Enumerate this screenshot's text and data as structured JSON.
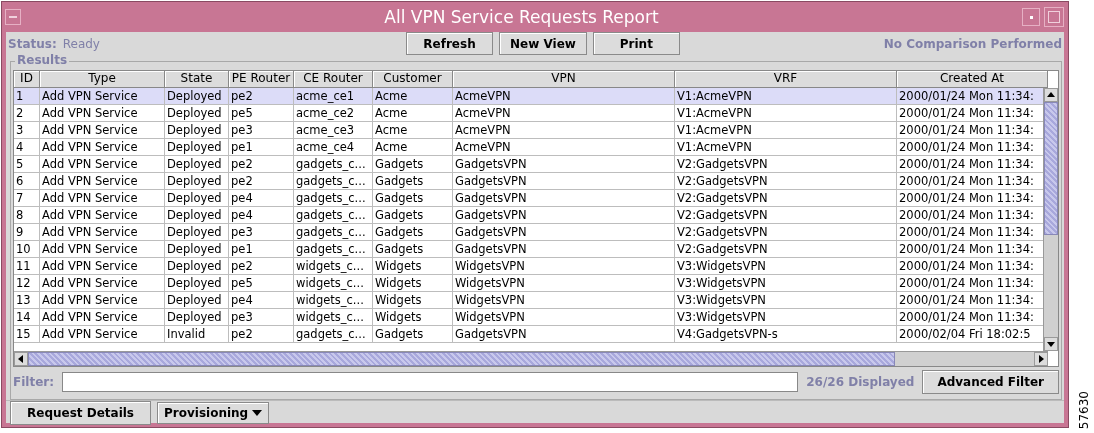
{
  "window": {
    "title": "All VPN Service Requests Report"
  },
  "toolbar": {
    "status_label": "Status:",
    "status_value": "Ready",
    "buttons": [
      "Refresh",
      "New View",
      "Print"
    ],
    "comparison": "No Comparison Performed"
  },
  "results": {
    "title": "Results",
    "columns": [
      "ID",
      "Type",
      "State",
      "PE Router",
      "CE Router",
      "Customer",
      "VPN",
      "VRF",
      "Created At"
    ],
    "rows": [
      {
        "selected": true,
        "cells": [
          "1",
          "Add VPN Service",
          "Deployed",
          "pe2",
          "acme_ce1",
          "Acme",
          "AcmeVPN",
          "V1:AcmeVPN",
          "2000/01/24 Mon 11:34:"
        ]
      },
      {
        "selected": false,
        "cells": [
          "2",
          "Add VPN Service",
          "Deployed",
          "pe5",
          "acme_ce2",
          "Acme",
          "AcmeVPN",
          "V1:AcmeVPN",
          "2000/01/24 Mon 11:34:"
        ]
      },
      {
        "selected": false,
        "cells": [
          "3",
          "Add VPN Service",
          "Deployed",
          "pe3",
          "acme_ce3",
          "Acme",
          "AcmeVPN",
          "V1:AcmeVPN",
          "2000/01/24 Mon 11:34:"
        ]
      },
      {
        "selected": false,
        "cells": [
          "4",
          "Add VPN Service",
          "Deployed",
          "pe1",
          "acme_ce4",
          "Acme",
          "AcmeVPN",
          "V1:AcmeVPN",
          "2000/01/24 Mon 11:34:"
        ]
      },
      {
        "selected": false,
        "cells": [
          "5",
          "Add VPN Service",
          "Deployed",
          "pe2",
          "gadgets_c...",
          "Gadgets",
          "GadgetsVPN",
          "V2:GadgetsVPN",
          "2000/01/24 Mon 11:34:"
        ]
      },
      {
        "selected": false,
        "cells": [
          "6",
          "Add VPN Service",
          "Deployed",
          "pe2",
          "gadgets_c...",
          "Gadgets",
          "GadgetsVPN",
          "V2:GadgetsVPN",
          "2000/01/24 Mon 11:34:"
        ]
      },
      {
        "selected": false,
        "cells": [
          "7",
          "Add VPN Service",
          "Deployed",
          "pe4",
          "gadgets_c...",
          "Gadgets",
          "GadgetsVPN",
          "V2:GadgetsVPN",
          "2000/01/24 Mon 11:34:"
        ]
      },
      {
        "selected": false,
        "cells": [
          "8",
          "Add VPN Service",
          "Deployed",
          "pe4",
          "gadgets_c...",
          "Gadgets",
          "GadgetsVPN",
          "V2:GadgetsVPN",
          "2000/01/24 Mon 11:34:"
        ]
      },
      {
        "selected": false,
        "cells": [
          "9",
          "Add VPN Service",
          "Deployed",
          "pe3",
          "gadgets_c...",
          "Gadgets",
          "GadgetsVPN",
          "V2:GadgetsVPN",
          "2000/01/24 Mon 11:34:"
        ]
      },
      {
        "selected": false,
        "cells": [
          "10",
          "Add VPN Service",
          "Deployed",
          "pe1",
          "gadgets_c...",
          "Gadgets",
          "GadgetsVPN",
          "V2:GadgetsVPN",
          "2000/01/24 Mon 11:34:"
        ]
      },
      {
        "selected": false,
        "cells": [
          "11",
          "Add VPN Service",
          "Deployed",
          "pe2",
          "widgets_c...",
          "Widgets",
          "WidgetsVPN",
          "V3:WidgetsVPN",
          "2000/01/24 Mon 11:34:"
        ]
      },
      {
        "selected": false,
        "cells": [
          "12",
          "Add VPN Service",
          "Deployed",
          "pe5",
          "widgets_c...",
          "Widgets",
          "WidgetsVPN",
          "V3:WidgetsVPN",
          "2000/01/24 Mon 11:34:"
        ]
      },
      {
        "selected": false,
        "cells": [
          "13",
          "Add VPN Service",
          "Deployed",
          "pe4",
          "widgets_c...",
          "Widgets",
          "WidgetsVPN",
          "V3:WidgetsVPN",
          "2000/01/24 Mon 11:34:"
        ]
      },
      {
        "selected": false,
        "cells": [
          "14",
          "Add VPN Service",
          "Deployed",
          "pe3",
          "widgets_c...",
          "Widgets",
          "WidgetsVPN",
          "V3:WidgetsVPN",
          "2000/01/24 Mon 11:34:"
        ]
      },
      {
        "selected": false,
        "cells": [
          "15",
          "Add VPN Service",
          "Invalid",
          "pe2",
          "gadgets_c...",
          "Gadgets",
          "GadgetsVPN",
          "V4:GadgetsVPN-s",
          "2000/02/04 Fri 18:02:5"
        ]
      }
    ]
  },
  "filter": {
    "label": "Filter:",
    "count": "26/26 Displayed",
    "button": "Advanced Filter"
  },
  "bottom_bar": {
    "buttons": [
      {
        "label": "Request Details",
        "kind": "button"
      },
      {
        "label": "Provisioning",
        "kind": "menu"
      }
    ]
  },
  "figure_number": "57630"
}
